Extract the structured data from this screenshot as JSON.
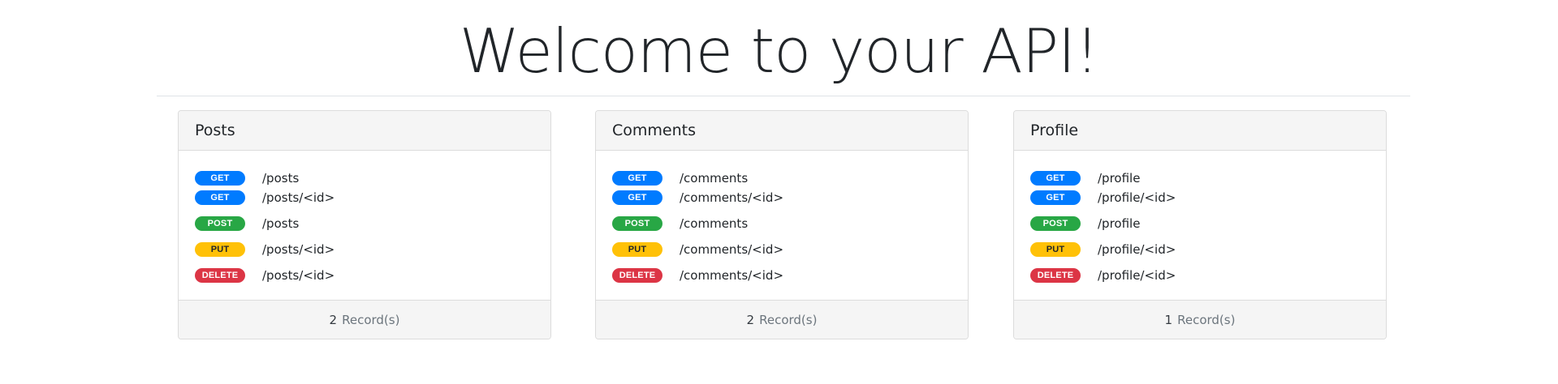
{
  "page": {
    "title": "Welcome to your API!"
  },
  "colors": {
    "get": "#007bff",
    "post": "#28a745",
    "put": "#ffc107",
    "delete": "#dc3545",
    "card_header_bg": "#f5f5f5",
    "border": "#dcdcdc"
  },
  "resources": [
    {
      "name": "Posts",
      "endpoints": [
        {
          "method": "GET",
          "path": "/posts"
        },
        {
          "method": "GET",
          "path": "/posts/<id>"
        },
        {
          "method": "POST",
          "path": "/posts"
        },
        {
          "method": "PUT",
          "path": "/posts/<id>"
        },
        {
          "method": "DELETE",
          "path": "/posts/<id>"
        }
      ],
      "record_count": "2",
      "record_label": "Record(s)"
    },
    {
      "name": "Comments",
      "endpoints": [
        {
          "method": "GET",
          "path": "/comments"
        },
        {
          "method": "GET",
          "path": "/comments/<id>"
        },
        {
          "method": "POST",
          "path": "/comments"
        },
        {
          "method": "PUT",
          "path": "/comments/<id>"
        },
        {
          "method": "DELETE",
          "path": "/comments/<id>"
        }
      ],
      "record_count": "2",
      "record_label": "Record(s)"
    },
    {
      "name": "Profile",
      "endpoints": [
        {
          "method": "GET",
          "path": "/profile"
        },
        {
          "method": "GET",
          "path": "/profile/<id>"
        },
        {
          "method": "POST",
          "path": "/profile"
        },
        {
          "method": "PUT",
          "path": "/profile/<id>"
        },
        {
          "method": "DELETE",
          "path": "/profile/<id>"
        }
      ],
      "record_count": "1",
      "record_label": "Record(s)"
    }
  ]
}
